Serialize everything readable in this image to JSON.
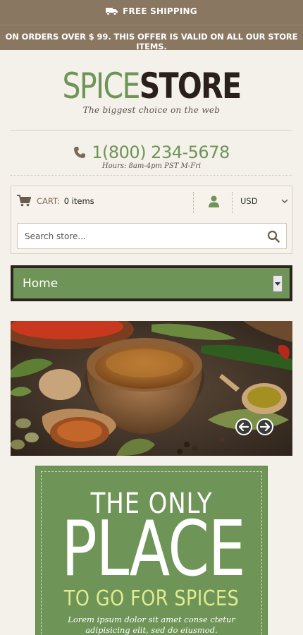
{
  "topbar": {
    "shipping_label": "FREE SHIPPING",
    "offer_text": "ON ORDERS OVER $ 99. THIS OFFER IS VALID ON ALL OUR STORE ITEMS."
  },
  "logo": {
    "part1": "SPICE",
    "part2": "STORE",
    "tagline": "The biggest choice on the web"
  },
  "contact": {
    "phone": "1(800) 234-5678",
    "hours": "Hours: 8am-4pm PST M-Fri"
  },
  "cart": {
    "label": "CART:",
    "count": "0 items"
  },
  "currency": {
    "selected": "USD"
  },
  "search": {
    "placeholder": "Search store..."
  },
  "nav": {
    "current": "Home"
  },
  "promo": {
    "line1": "THE ONLY",
    "line2": "PLACE",
    "line3": "TO GO FOR SPICES",
    "body": "Lorem ipsum dolor sit amet conse ctetur adipisicing elit, sed do eiusmod."
  },
  "colors": {
    "topbar": "#8a7761",
    "accent_green": "#6f9457",
    "dark_brown": "#2a1f1a",
    "highlight_yellow": "#e0ec8e",
    "background": "#f4f1ea"
  }
}
